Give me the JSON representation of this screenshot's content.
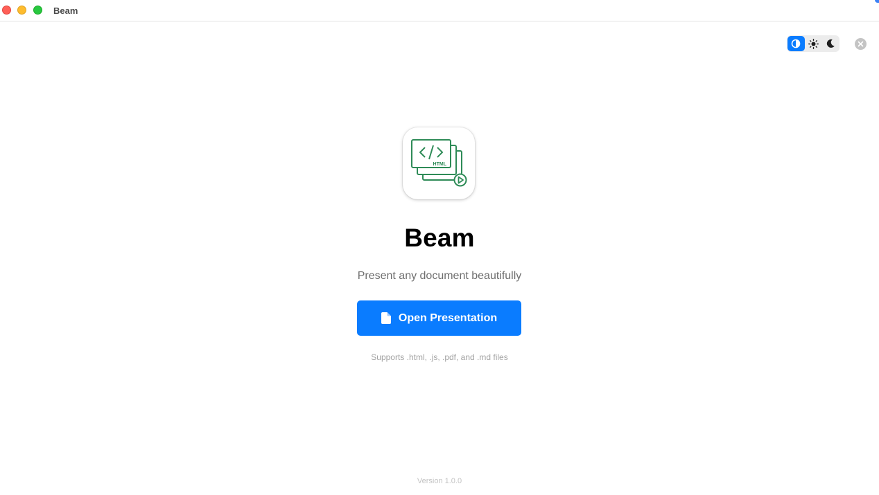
{
  "window": {
    "title": "Beam"
  },
  "theme_toggle": {
    "options": [
      {
        "name": "system",
        "icon": "half-circle-icon",
        "active": true
      },
      {
        "name": "light",
        "icon": "sun-icon",
        "active": false
      },
      {
        "name": "dark",
        "icon": "moon-icon",
        "active": false
      }
    ]
  },
  "dismiss": {
    "icon": "close-icon"
  },
  "app": {
    "name": "Beam",
    "tagline": "Present any document beautifully",
    "icon": "html-slides-play-icon",
    "icon_badge": "HTML"
  },
  "open_button": {
    "label": "Open Presentation",
    "icon": "document-icon"
  },
  "supports_text": "Supports .html, .js, .pdf, and .md files",
  "version_text": "Version 1.0.0",
  "colors": {
    "accent": "#0a7cff",
    "icon_green": "#2e8b57",
    "close": "#ff5f57",
    "minimize": "#febc2e",
    "maximize": "#28c840"
  }
}
